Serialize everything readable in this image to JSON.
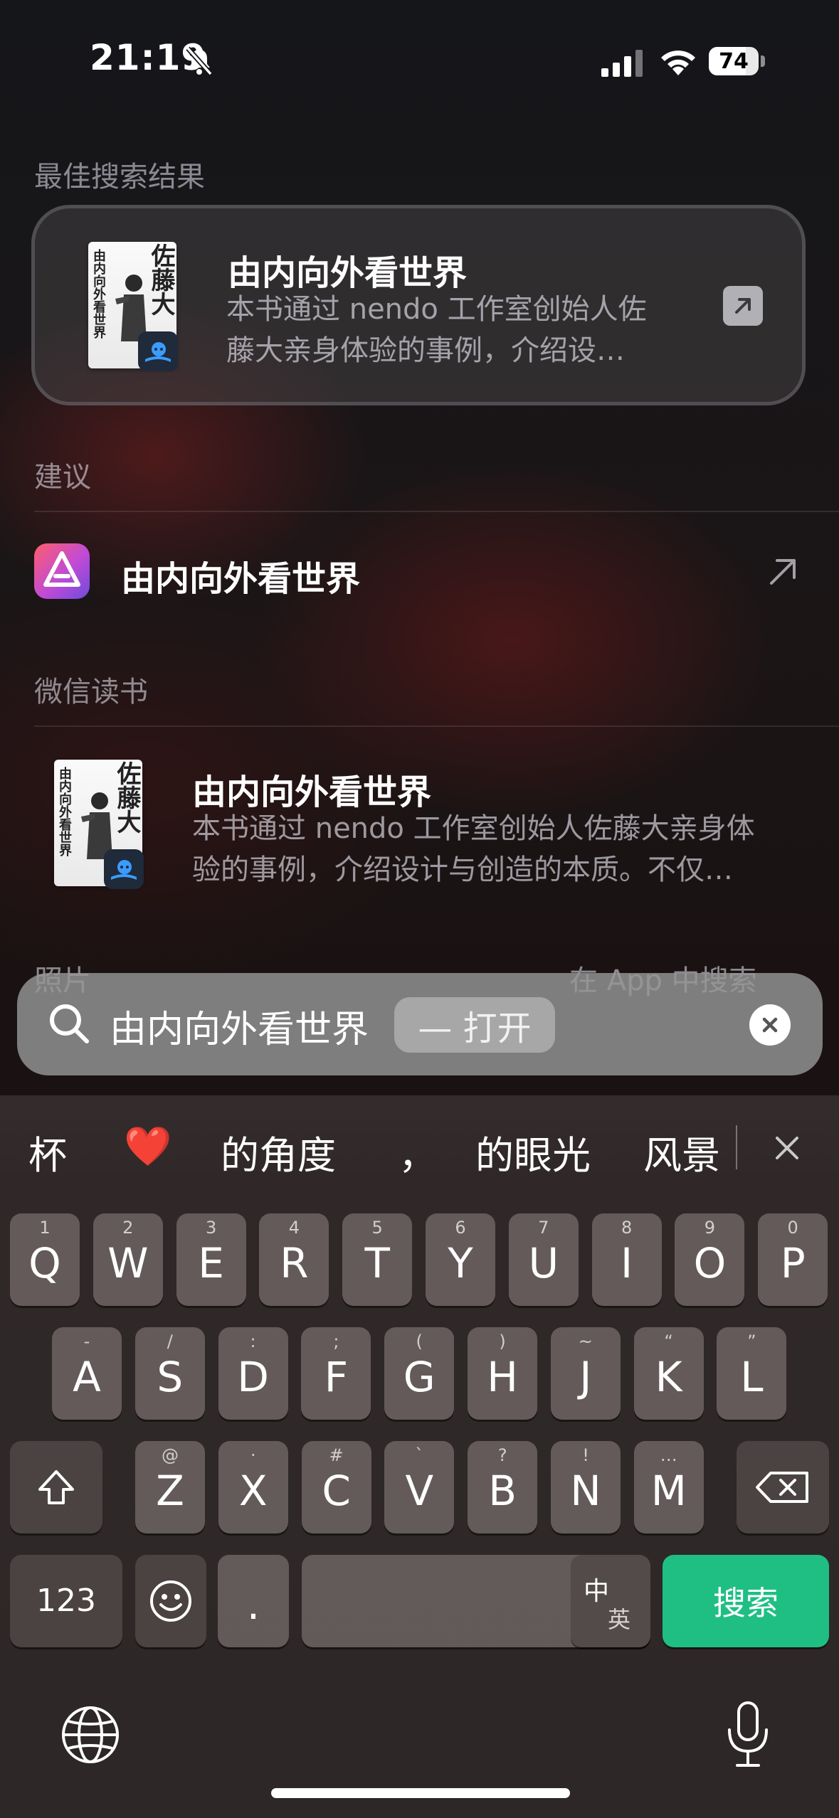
{
  "status_bar": {
    "time": "21:19",
    "battery": "74",
    "battery_level": 0.74
  },
  "top_hit": {
    "section_title": "最佳搜索结果",
    "title": "由内向外看世界",
    "description_line1": "本书通过 nendo 工作室创始人佐",
    "description_line2": "藤大亲身体验的事例，介绍设…",
    "cover_author": "佐藤大",
    "cover_title": "由内向外看世界"
  },
  "suggestions": {
    "section_title": "建议",
    "items": [
      {
        "label": "由内向外看世界"
      }
    ]
  },
  "wechat_reading": {
    "section_title": "微信读书",
    "title": "由内向外看世界",
    "description_line1": "本书通过 nendo 工作室创始人佐藤大亲身体",
    "description_line2": "验的事例，介绍设计与创造的本质。不仅…",
    "cover_author": "佐藤大",
    "cover_title": "由内向外看世界"
  },
  "photos": {
    "section_title": "照片",
    "search_in_app": "在 App 中搜索"
  },
  "search": {
    "query": "由内向外看世界",
    "open_label": "— 打开"
  },
  "candidates": [
    "杯",
    "❤️",
    "的角度",
    "，",
    "的眼光",
    "风景"
  ],
  "keyboard": {
    "row1": [
      {
        "main": "Q",
        "sub": "1"
      },
      {
        "main": "W",
        "sub": "2"
      },
      {
        "main": "E",
        "sub": "3"
      },
      {
        "main": "R",
        "sub": "4"
      },
      {
        "main": "T",
        "sub": "5"
      },
      {
        "main": "Y",
        "sub": "6"
      },
      {
        "main": "U",
        "sub": "7"
      },
      {
        "main": "I",
        "sub": "8"
      },
      {
        "main": "O",
        "sub": "9"
      },
      {
        "main": "P",
        "sub": "0"
      }
    ],
    "row2": [
      {
        "main": "A",
        "sub": "-"
      },
      {
        "main": "S",
        "sub": "/"
      },
      {
        "main": "D",
        "sub": ":"
      },
      {
        "main": "F",
        "sub": ";"
      },
      {
        "main": "G",
        "sub": "("
      },
      {
        "main": "H",
        "sub": ")"
      },
      {
        "main": "J",
        "sub": "~"
      },
      {
        "main": "K",
        "sub": "“"
      },
      {
        "main": "L",
        "sub": "”"
      }
    ],
    "row3": [
      {
        "main": "Z",
        "sub": "@"
      },
      {
        "main": "X",
        "sub": "·"
      },
      {
        "main": "C",
        "sub": "#"
      },
      {
        "main": "V",
        "sub": "`"
      },
      {
        "main": "B",
        "sub": "?"
      },
      {
        "main": "N",
        "sub": "!"
      },
      {
        "main": "M",
        "sub": "…"
      }
    ],
    "numbers_label": "123",
    "period_label": ".",
    "lang_top": "中",
    "lang_bottom": "英",
    "search_label": "搜索"
  },
  "colors": {
    "search_key": "#1fbf84",
    "accent_icon": "#c04bd6"
  }
}
